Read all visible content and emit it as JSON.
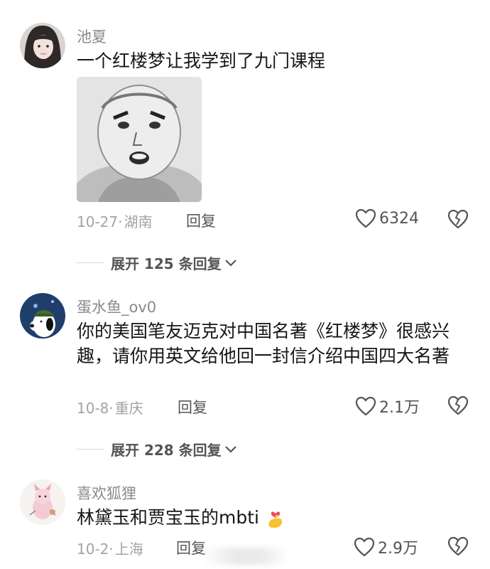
{
  "comments": [
    {
      "username": "池夏",
      "text": "一个红楼梦让我学到了九门课程",
      "date": "10-27",
      "separator": "·",
      "location": "湖南",
      "reply_label": "回复",
      "likes": "6324",
      "expand_label": "展开 125 条回复"
    },
    {
      "username": "蛋水鱼_ov0",
      "text": "你的美国笔友迈克对中国名著《红楼梦》很感兴趣，请你用英文给他回一封信介绍中国四大名著",
      "date": "10-8",
      "separator": "·",
      "location": "重庆",
      "reply_label": "回复",
      "likes": "2.1万",
      "expand_label": "展开 228 条回复"
    },
    {
      "username": "喜欢狐狸",
      "text": "林黛玉和贾宝玉的mbti",
      "emoji": "finger-heart-emoji",
      "date": "10-2",
      "separator": "·",
      "location": "上海",
      "reply_label": "回复",
      "likes": "2.9万"
    }
  ],
  "icons": {
    "like": "heart-outline-icon",
    "dislike": "broken-heart-icon",
    "expand": "chevron-down-icon"
  },
  "colors": {
    "username": "#8a8a8a",
    "text": "#161616",
    "meta": "#a3a3a3",
    "action": "#555555"
  }
}
